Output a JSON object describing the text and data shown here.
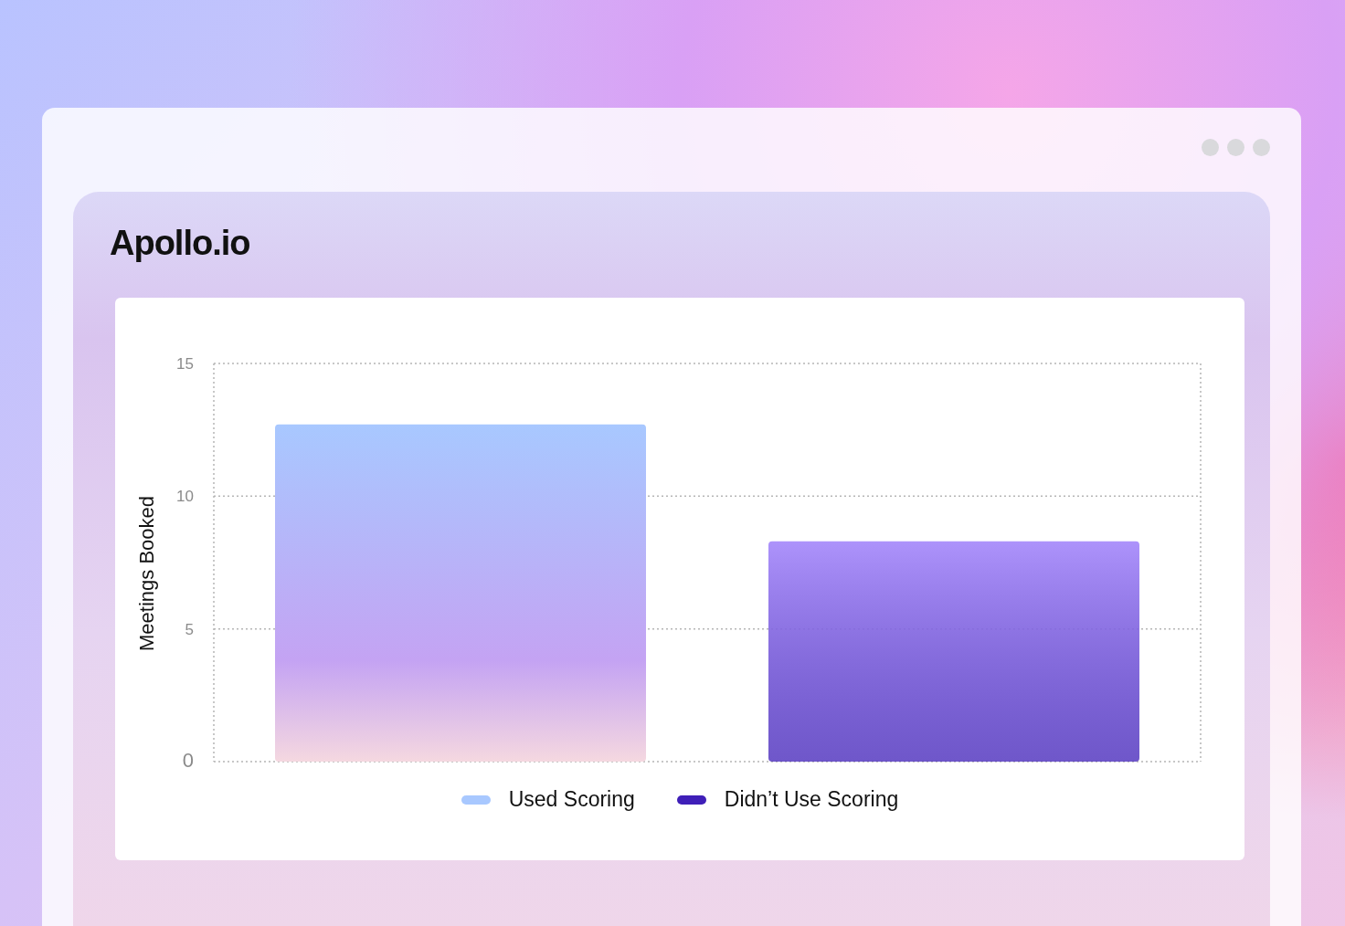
{
  "logo": "Apollo.io",
  "chart": {
    "chart_data": {
      "type": "bar",
      "ylabel": "Meetings Booked",
      "ylim": [
        0,
        15
      ],
      "yticks": [
        0,
        5,
        10,
        15
      ],
      "series": [
        {
          "name": "Used Scoring",
          "color": "#a8c8ff",
          "values": [
            12.7
          ]
        },
        {
          "name": "Didn’t Use Scoring",
          "color": "#3f1fb8",
          "values": [
            8.3
          ]
        }
      ]
    }
  }
}
